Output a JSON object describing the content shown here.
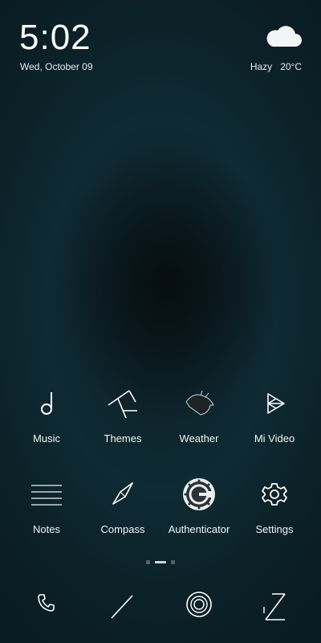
{
  "status": {
    "time": "5:02",
    "date": "Wed, October 09",
    "weather_condition": "Hazy",
    "temperature": "20°C",
    "weather_icon": "cloud-icon"
  },
  "apps_row1": [
    {
      "label": "Music",
      "icon": "music-note-icon"
    },
    {
      "label": "Themes",
      "icon": "themes-icon"
    },
    {
      "label": "Weather",
      "icon": "weather-icon"
    },
    {
      "label": "Mi Video",
      "icon": "video-play-icon"
    }
  ],
  "apps_row2": [
    {
      "label": "Notes",
      "icon": "notes-icon"
    },
    {
      "label": "Compass",
      "icon": "compass-icon"
    },
    {
      "label": "Authenticator",
      "icon": "authenticator-icon"
    },
    {
      "label": "Settings",
      "icon": "gear-icon"
    }
  ],
  "page_indicator": {
    "pages": 3,
    "active": 1
  },
  "dock": [
    {
      "icon": "phone-icon"
    },
    {
      "icon": "browser-icon"
    },
    {
      "icon": "camera-icon"
    },
    {
      "icon": "gallery-icon"
    }
  ]
}
